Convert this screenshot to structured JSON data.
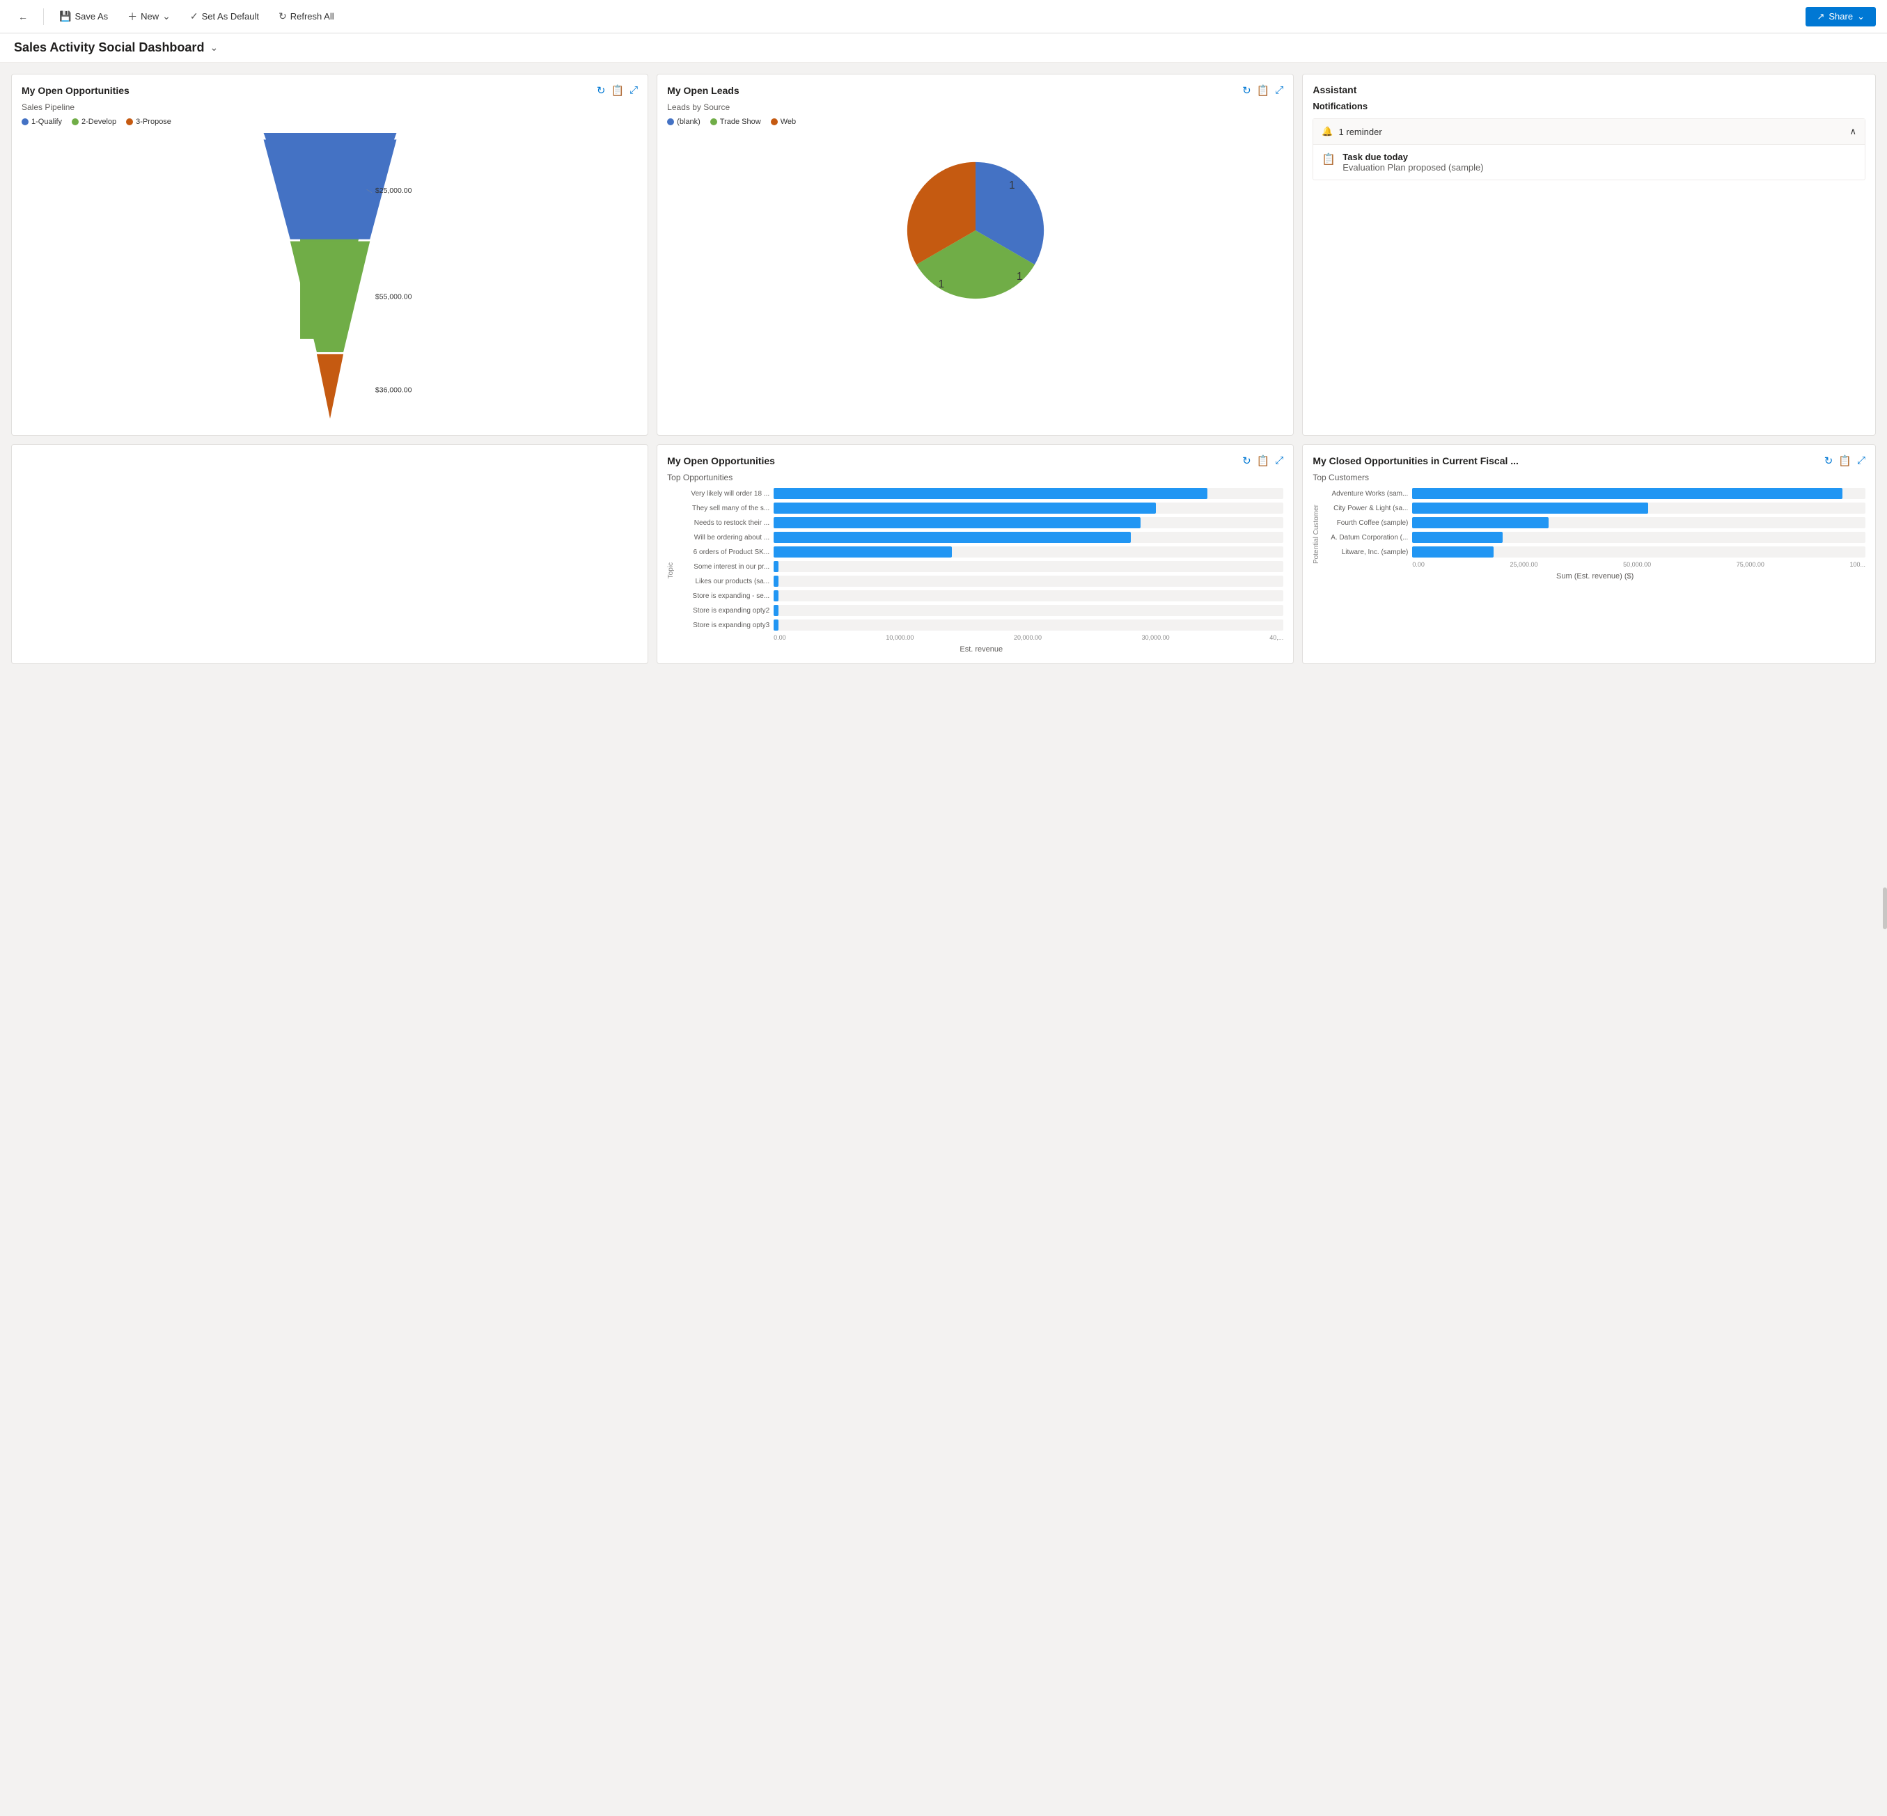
{
  "toolbar": {
    "back_label": "←",
    "save_as_label": "Save As",
    "new_label": "New",
    "set_default_label": "Set As Default",
    "refresh_label": "Refresh All",
    "share_label": "Share"
  },
  "page": {
    "title": "Sales Activity Social Dashboard",
    "title_chevron": "⌄"
  },
  "my_open_opportunities_funnel": {
    "title": "My Open Opportunities",
    "subtitle": "Sales Pipeline",
    "legend": [
      {
        "label": "1-Qualify",
        "color": "#4472c4"
      },
      {
        "label": "2-Develop",
        "color": "#70ad47"
      },
      {
        "label": "3-Propose",
        "color": "#c55a11"
      }
    ],
    "labels": [
      {
        "value": "$25,000.00",
        "y": 30
      },
      {
        "value": "$55,000.00",
        "y": 52
      },
      {
        "value": "$36,000.00",
        "y": 85
      }
    ]
  },
  "my_open_leads": {
    "title": "My Open Leads",
    "subtitle": "Leads by Source",
    "legend": [
      {
        "label": "(blank)",
        "color": "#4472c4"
      },
      {
        "label": "Trade Show",
        "color": "#70ad47"
      },
      {
        "label": "Web",
        "color": "#c55a11"
      }
    ],
    "pie": {
      "segments": [
        {
          "label": "blank",
          "value": 1,
          "color": "#4472c4",
          "startAngle": 0,
          "endAngle": 120
        },
        {
          "label": "Trade Show",
          "value": 1,
          "color": "#70ad47",
          "startAngle": 120,
          "endAngle": 240
        },
        {
          "label": "Web",
          "value": 1,
          "color": "#c55a11",
          "startAngle": 240,
          "endAngle": 360
        }
      ]
    }
  },
  "assistant": {
    "title": "Assistant",
    "notifications_label": "Notifications",
    "reminder_count": "1 reminder",
    "task_title": "Task due today",
    "task_detail": "Evaluation Plan proposed (sample)"
  },
  "my_open_opportunities_bar": {
    "title": "My Open Opportunities",
    "subtitle": "Top Opportunities",
    "bars": [
      {
        "label": "Very likely will order 18 ...",
        "value": 85,
        "display": ""
      },
      {
        "label": "They sell many of the s...",
        "value": 75,
        "display": ""
      },
      {
        "label": "Needs to restock their ...",
        "value": 72,
        "display": ""
      },
      {
        "label": "Will be ordering about ...",
        "value": 70,
        "display": ""
      },
      {
        "label": "6 orders of Product SK...",
        "value": 35,
        "display": ""
      },
      {
        "label": "Some interest in our pr...",
        "value": 0,
        "display": ""
      },
      {
        "label": "Likes our products (sa...",
        "value": 0,
        "display": ""
      },
      {
        "label": "Store is expanding - se...",
        "value": 0,
        "display": ""
      },
      {
        "label": "Store is expanding opty2",
        "value": 0,
        "display": ""
      },
      {
        "label": "Store is expanding opty3",
        "value": 0,
        "display": ""
      }
    ],
    "axis_labels": [
      "0.00",
      "10,000.00",
      "20,000.00",
      "30,000.00",
      "40,..."
    ],
    "axis_title": "Est. revenue",
    "y_axis_label": "Topic"
  },
  "my_closed_opportunities": {
    "title": "My Closed Opportunities in Current Fiscal ...",
    "subtitle": "Top Customers",
    "bars": [
      {
        "label": "Adventure Works (sam...",
        "value": 95,
        "display": ""
      },
      {
        "label": "City Power & Light (sa...",
        "value": 52,
        "display": ""
      },
      {
        "label": "Fourth Coffee (sample)",
        "value": 30,
        "display": ""
      },
      {
        "label": "A. Datum Corporation (...",
        "value": 20,
        "display": ""
      },
      {
        "label": "Litware, Inc. (sample)",
        "value": 18,
        "display": ""
      }
    ],
    "axis_labels": [
      "0.00",
      "25,000.00",
      "50,000.00",
      "75,000.00",
      "100..."
    ],
    "axis_title": "Sum (Est. revenue) ($)",
    "y_axis_label": "Potential Customer"
  }
}
